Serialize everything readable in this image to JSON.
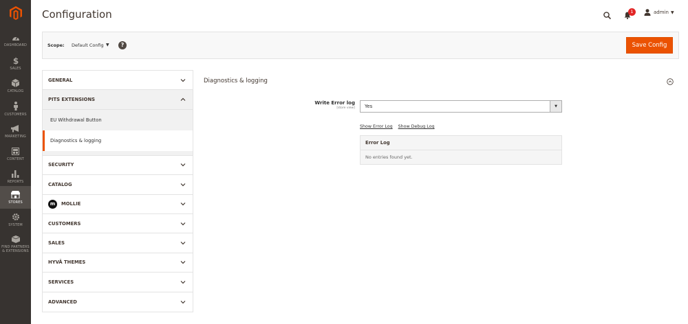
{
  "header": {
    "title": "Configuration",
    "notifications_count": "1",
    "user_name": "admin"
  },
  "nav": {
    "items": [
      {
        "label": "DASHBOARD",
        "icon": "dashboard-icon"
      },
      {
        "label": "SALES",
        "icon": "dollar-icon"
      },
      {
        "label": "CATALOG",
        "icon": "cube-icon"
      },
      {
        "label": "CUSTOMERS",
        "icon": "person-icon"
      },
      {
        "label": "MARKETING",
        "icon": "megaphone-icon"
      },
      {
        "label": "CONTENT",
        "icon": "layout-icon"
      },
      {
        "label": "REPORTS",
        "icon": "bar-chart-icon"
      },
      {
        "label": "STORES",
        "icon": "store-icon",
        "active": true
      },
      {
        "label": "SYSTEM",
        "icon": "gear-icon"
      },
      {
        "label": "FIND PARTNERS & EXTENSIONS",
        "icon": "box-icon"
      }
    ]
  },
  "scope": {
    "label": "Scope:",
    "value": "Default Config",
    "help": "?"
  },
  "toolbar": {
    "save_label": "Save Config"
  },
  "tabs": {
    "general": "GENERAL",
    "pits": "PITS EXTENSIONS",
    "pits_items": [
      "EU Withdrawal Button",
      "Diagnostics & logging"
    ],
    "security": "SECURITY",
    "catalog": "CATALOG",
    "mollie": "MOLLIE",
    "mollie_logo": "m",
    "customers": "CUSTOMERS",
    "sales": "SALES",
    "hyva": "HYVÄ THEMES",
    "services": "SERVICES",
    "advanced": "ADVANCED"
  },
  "section": {
    "title": "Diagnostics & logging",
    "field_label": "Write Error log",
    "field_scope": "[store view]",
    "field_value": "Yes",
    "link_error": "Show Error Log",
    "link_debug": "Show Debug Log",
    "log_title": "Error Log",
    "log_empty": "No entries found yet."
  },
  "colors": {
    "accent": "#eb5202",
    "nav_bg": "#373330",
    "nav_active": "#524d49"
  }
}
